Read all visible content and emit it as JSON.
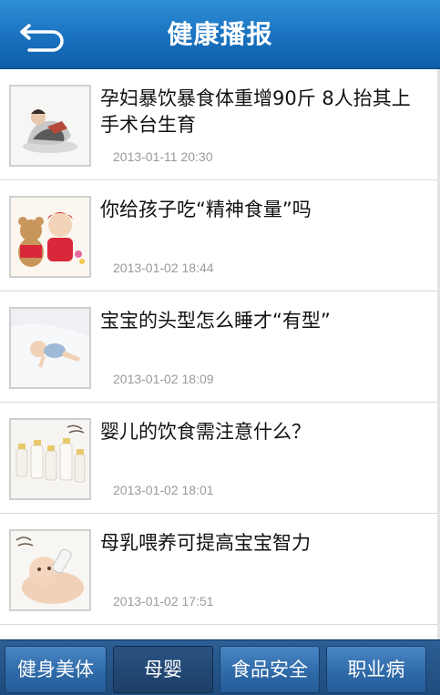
{
  "header": {
    "title": "健康播报",
    "back_icon": "back-arrow-icon"
  },
  "articles": [
    {
      "title": "孕妇暴饮暴食体重增90斤 8人抬其上手术台生育",
      "date": "2013-01-11 20:30",
      "thumb": "pregnant-woman-thumbnail"
    },
    {
      "title": "你给孩子吃“精神食量”吗",
      "date": "2013-01-02 18:44",
      "thumb": "child-with-teddy-bear-thumbnail"
    },
    {
      "title": "宝宝的头型怎么睡才“有型”",
      "date": "2013-01-02 18:09",
      "thumb": "sleeping-baby-thumbnail"
    },
    {
      "title": "婴儿的饮食需注意什么？",
      "date": "2013-01-02 18:01",
      "thumb": "milk-bottles-thumbnail"
    },
    {
      "title": "母乳喂养可提高宝宝智力",
      "date": "2013-01-02 17:51",
      "thumb": "baby-drinking-bottle-thumbnail"
    }
  ],
  "tabs": [
    {
      "label": "健身美体",
      "active": false
    },
    {
      "label": "母婴",
      "active": true
    },
    {
      "label": "食品安全",
      "active": false
    },
    {
      "label": "职业病",
      "active": false
    }
  ],
  "colors": {
    "header": "#1b74c1",
    "tabbar": "#1f4b7c",
    "date": "#9a9a9a"
  }
}
